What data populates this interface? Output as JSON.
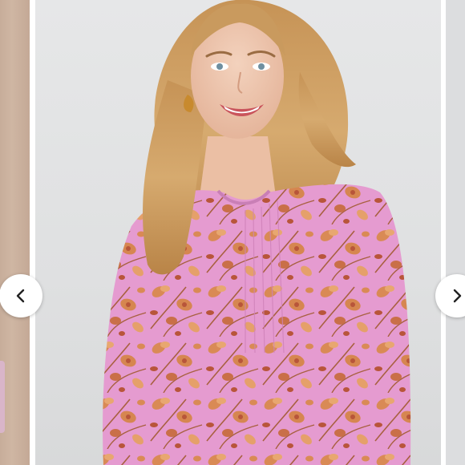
{
  "carousel": {
    "prev_button_icon": "chevron-left-icon",
    "next_button_icon": "chevron-right-icon",
    "colors": {
      "main_background": "#e3e4e5",
      "prev_slide_tone": "#c9b09d",
      "blouse_pink": "#e59bd0",
      "floral_orange": "#d98a55",
      "floral_rust": "#b8553a",
      "hair_blonde": "#c99a5e",
      "button_background": "#ffffff",
      "chevron": "#222222"
    }
  }
}
